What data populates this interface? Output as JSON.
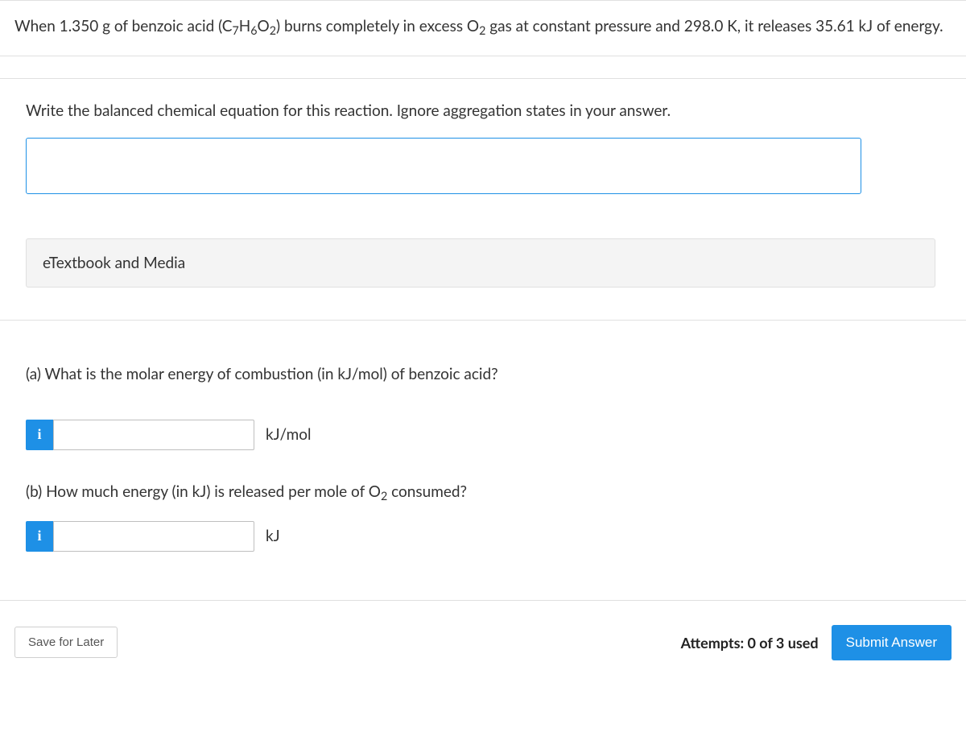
{
  "intro": {
    "text_before_formula": "When 1.350 g of benzoic acid (C",
    "f1_sub1": "7",
    "f1_mid1": "H",
    "f1_sub2": "6",
    "f1_mid2": "O",
    "f1_sub3": "2",
    "text_mid": ") burns completely in excess O",
    "f2_sub": "2",
    "text_after": " gas at constant pressure and 298.0 K, it releases 35.61 kJ of energy."
  },
  "partA": {
    "prompt": "Write the balanced chemical equation for this reaction. Ignore aggregation states in your answer.",
    "equation_value": "",
    "etextbook_label": "eTextbook and Media"
  },
  "partB": {
    "qa": "(a) What is the molar energy of combustion (in kJ/mol) of benzoic acid?",
    "qa_unit": "kJ/mol",
    "qa_value": "",
    "qb_before": "(b) How much energy (in kJ) is released per mole of O",
    "qb_sub": "2",
    "qb_after": " consumed?",
    "qb_unit": "kJ",
    "qb_value": "",
    "info_glyph": "i"
  },
  "footer": {
    "save_label": "Save for Later",
    "attempts_label": "Attempts: 0 of 3 used",
    "submit_label": "Submit Answer"
  }
}
